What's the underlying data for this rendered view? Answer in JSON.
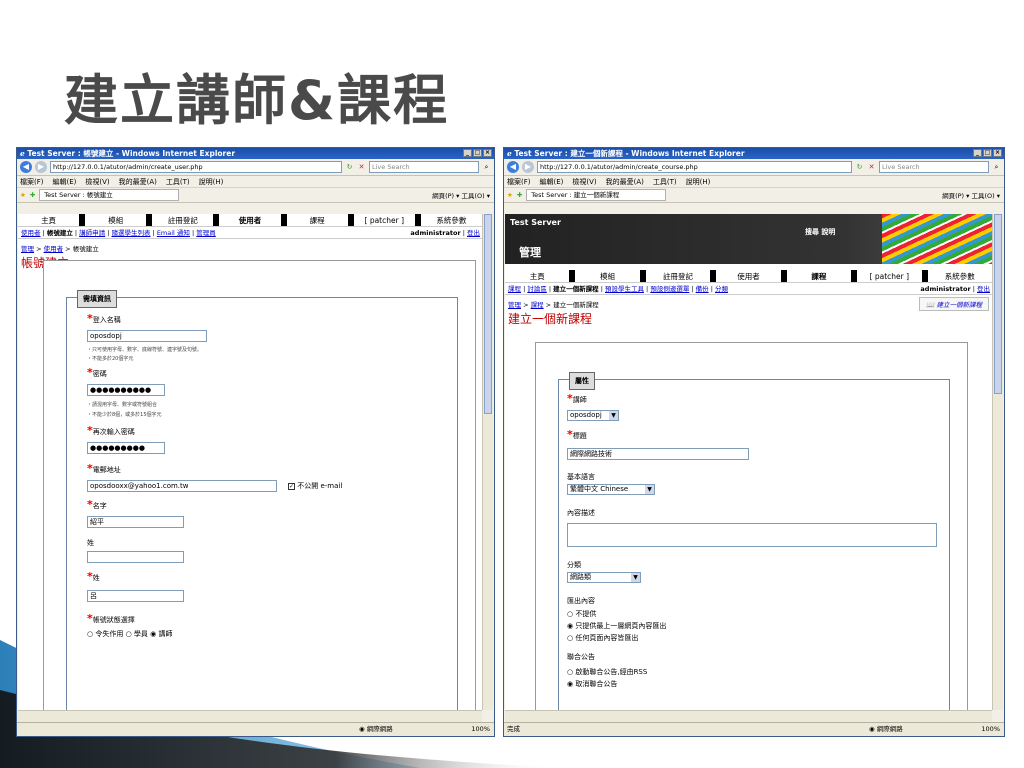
{
  "slide": {
    "title": "建立講師&課程"
  },
  "browser_common": {
    "search_placeholder": "Live Search",
    "menu": [
      "檔案(F)",
      "編輯(E)",
      "檢視(V)",
      "我的最愛(A)",
      "工具(T)",
      "說明(H)"
    ],
    "fav_tools": "網頁(P) ▾ 工具(O) ▾",
    "zone": "網際網路",
    "zoom": "100%"
  },
  "left": {
    "window_title": "Test Server : 帳號建立 - Windows Internet Explorer",
    "url": "http://127.0.0.1/atutor/admin/create_user.php",
    "tab": "Test Server : 帳號建立",
    "status": "",
    "nav": [
      "主頁",
      "模組",
      "註冊登記",
      "使用者",
      "課程",
      "[ patcher ]",
      "系統參數"
    ],
    "subnav": {
      "users": "使用者",
      "create": "帳號建立",
      "instructor_apps": "講師申請",
      "master_list": "隨選學生列表",
      "email": "Email 通知",
      "admins": "管理員"
    },
    "user": "administrator",
    "logout": "登出",
    "crumb": {
      "admin": "管理",
      "users": "使用者",
      "current": "帳號建立"
    },
    "page_title": "帳號建立",
    "legend": "需填資訊",
    "login_label": "登入名稱",
    "login_value": "oposdopj",
    "login_hint1": "・只可使用字母、數字、底線符號、連字號及句號。",
    "login_hint2": "・不能多於20個字元",
    "password_label": "密碼",
    "password_value": "●●●●●●●●●●",
    "password_hint1": "・請混用字母、數字或符號組合",
    "password_hint2": "・不能少於8個，或多於15個字元",
    "password2_label": "再次輸入密碼",
    "password2_value": "●●●●●●●●●",
    "email_label": "電郵地址",
    "email_value": "oposdooxx@yahoo1.com.tw",
    "email_private": "不公開 e-mail",
    "firstname_label": "名字",
    "firstname_value": "紹平",
    "middle_label": "姓",
    "middle_value": "",
    "lastname_label": "姓",
    "lastname_value": "呂",
    "status_label": "帳號狀態選擇",
    "status_options": [
      "令失作用",
      "學員",
      "講師"
    ]
  },
  "right": {
    "window_title": "Test Server : 建立一個新課程 - Windows Internet Explorer",
    "url": "http://127.0.0.1/atutor/admin/create_course.php",
    "tab": "Test Server : 建立一個新課程",
    "status": "完成",
    "banner_server": "Test Server",
    "banner_links": "搜尋  說明",
    "banner_mgmt": "管理",
    "nav": [
      "主頁",
      "模組",
      "註冊登記",
      "使用者",
      "課程",
      "[ patcher ]",
      "系統參數"
    ],
    "subnav": {
      "courses": "課程",
      "forums": "討論區",
      "create": "建立一個新課程",
      "default_tools": "預設學生工具",
      "default_blocks": "預設側邊選單",
      "backups": "備份",
      "categories": "分類"
    },
    "user": "administrator",
    "logout": "登出",
    "crumb": {
      "admin": "管理",
      "courses": "課程",
      "current": "建立一個新課程"
    },
    "wizard": "建立一個新課程",
    "page_title": "建立一個新課程",
    "legend": "屬性",
    "instructor_label": "講師",
    "instructor_value": "oposdopj",
    "title_label": "標題",
    "title_value": "網際網路技術",
    "lang_label": "基本語言",
    "lang_value": "繁體中文  Chinese",
    "desc_label": "內容描述",
    "cat_label": "分類",
    "cat_value": "網路類",
    "export_label": "匯出內容",
    "export_options": [
      "不提供",
      "只提供最上一層網頁內容匯出",
      "任何頁面內容皆匯出"
    ],
    "syndicate_label": "聯合公告",
    "syndicate_options": [
      "啟動聯合公告,經由RSS",
      "取消聯合公告"
    ]
  }
}
